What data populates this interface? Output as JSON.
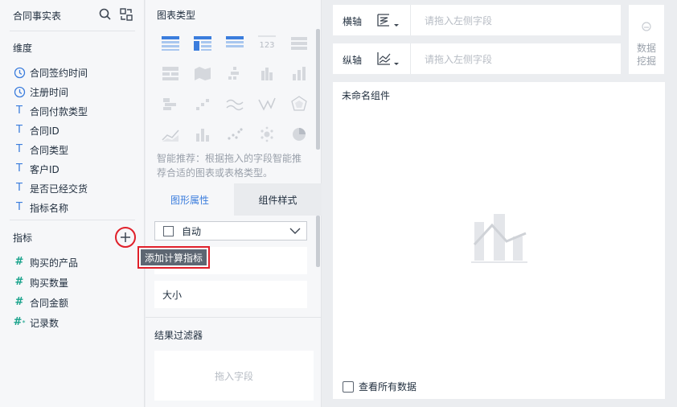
{
  "left_panel": {
    "title": "合同事实表",
    "dimensions_label": "维度",
    "dimensions": [
      {
        "label": "合同签约时间",
        "type": "date"
      },
      {
        "label": "注册时间",
        "type": "date"
      },
      {
        "label": "合同付款类型",
        "type": "text"
      },
      {
        "label": "合同ID",
        "type": "text"
      },
      {
        "label": "合同类型",
        "type": "text"
      },
      {
        "label": "客户ID",
        "type": "text"
      },
      {
        "label": "是否已经交货",
        "type": "text"
      },
      {
        "label": "指标名称",
        "type": "text"
      }
    ],
    "metrics_label": "指标",
    "metrics": [
      {
        "label": "购买的产品",
        "type": "number"
      },
      {
        "label": "购买数量",
        "type": "number"
      },
      {
        "label": "合同金额",
        "type": "number"
      },
      {
        "label": "记录数",
        "type": "count"
      }
    ],
    "tooltip": "添加计算指标",
    "glyph_t": "T",
    "glyph_hash": "#",
    "glyph_star": "*"
  },
  "middle_panel": {
    "chart_type_label": "图表类型",
    "hint": "智能推荐：根据拖入的字段智能推荐合适的图表或表格类型。",
    "tabs": {
      "graphic": "图形属性",
      "component": "组件样式"
    },
    "select_value": "自动",
    "size_label": "大小",
    "filter_label": "结果过滤器",
    "drop_placeholder": "拖入字段",
    "icon_123": "123"
  },
  "axes": {
    "x_label": "横轴",
    "y_label": "纵轴",
    "placeholder": "请拖入左侧字段"
  },
  "mining_label": "数据挖掘",
  "canvas": {
    "title": "未命名组件",
    "view_all": "查看所有数据"
  },
  "colors": {
    "accent": "#3b7ddd",
    "metric": "#19a38c",
    "highlight": "#e0202a"
  }
}
